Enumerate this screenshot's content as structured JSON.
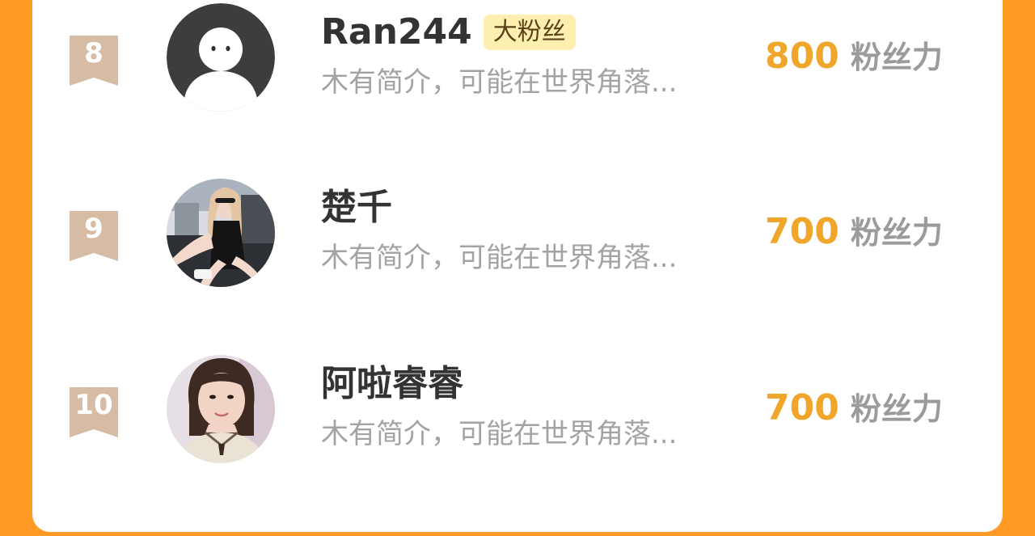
{
  "colors": {
    "background": "#ff9a24",
    "card": "#ffffff",
    "score": "#f0a62a",
    "rank_ribbon": "#d6bca4",
    "badge_bg": "#fcefaf",
    "bio_text": "#a3a3a3"
  },
  "ranking": [
    {
      "rank": "8",
      "name": "Ran244",
      "badge": "大粉丝",
      "bio": "木有简介，可能在世界角落...",
      "score": "800",
      "score_unit": "粉丝力",
      "avatar": "default-silhouette-avatar"
    },
    {
      "rank": "9",
      "name": "楚千",
      "badge": "",
      "bio": "木有简介，可能在世界角落...",
      "score": "700",
      "score_unit": "粉丝力",
      "avatar": "photo-avatar"
    },
    {
      "rank": "10",
      "name": "阿啦睿睿",
      "badge": "",
      "bio": "木有简介，可能在世界角落...",
      "score": "700",
      "score_unit": "粉丝力",
      "avatar": "photo-avatar"
    }
  ]
}
